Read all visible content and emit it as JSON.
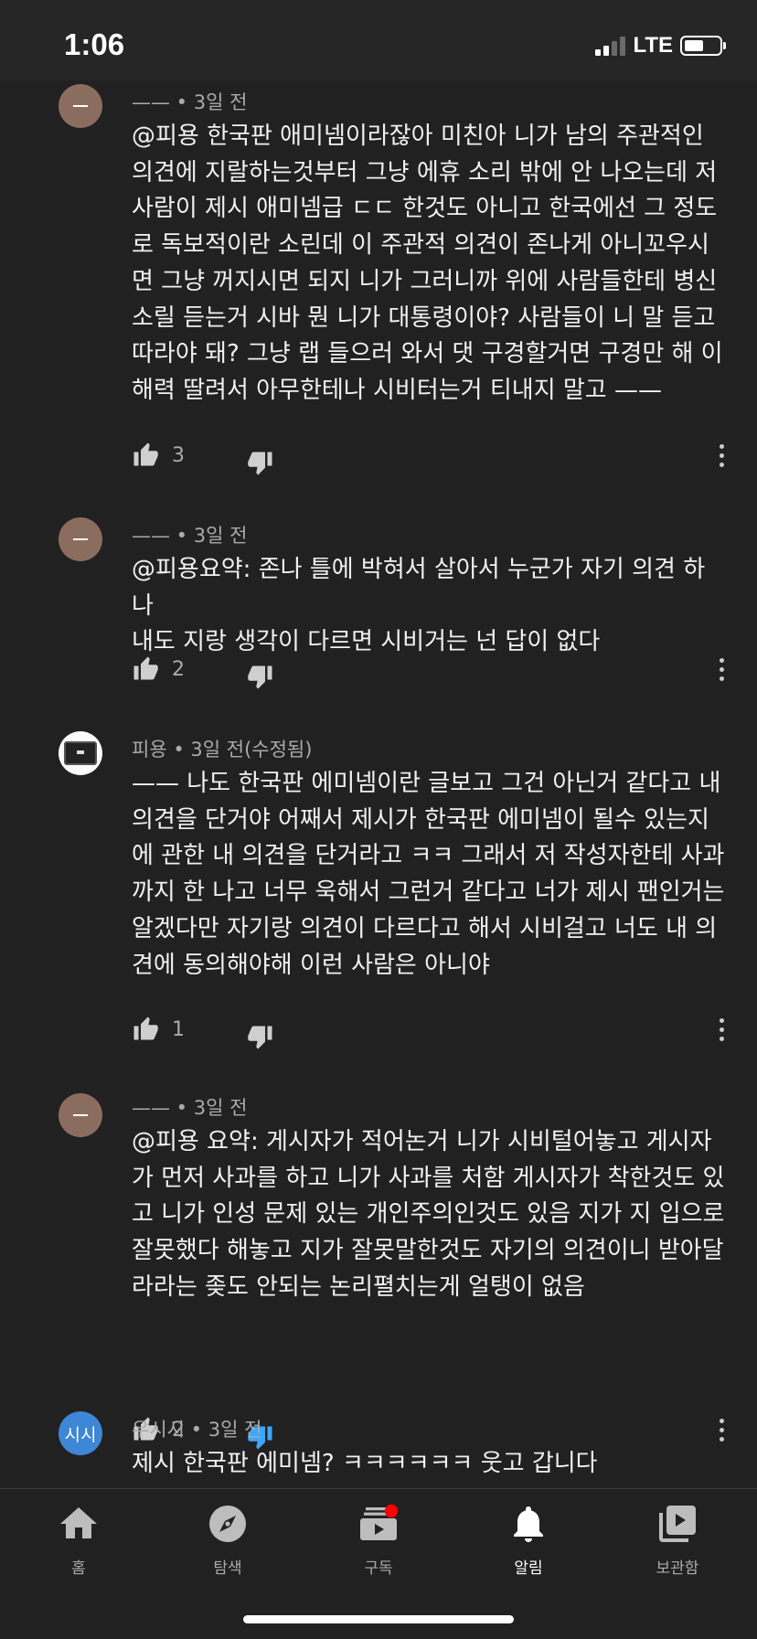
{
  "status": {
    "time": "1:06",
    "network": "LTE"
  },
  "comments": [
    {
      "avatar_initial": "",
      "author": "——",
      "age": "3일 전",
      "text": "@피용 한국판 애미넴이라잖아 미친아 니가 남의 주관적인\n의견에 지랄하는것부터 그냥 에휴 소리 밖에 안 나오는데 저\n사람이 제시 애미넴급 ㄷㄷ 한것도 아니고 한국에선 그 정도\n로 독보적이란 소린데 이 주관적 의견이 존나게 아니꼬우시\n면 그냥 꺼지시면 되지 니가 그러니까 위에 사람들한테 병신\n소릴 듣는거 시바 뭔 니가 대통령이야? 사람들이 니 말 듣고\n따라야 돼? 그냥 랩 들으러 와서 댓 구경할거면 구경만 해 이\n해력 딸려서 아무한테나 시비터는거 티내지 말고 ——",
      "likes": "3",
      "disliked": false
    },
    {
      "avatar_initial": "",
      "author": "——",
      "age": "3일 전",
      "text": "@피용요약:  존나 틀에 박혀서 살아서 누군가 자기 의견 하나\n내도 지랑 생각이 다르면 시비거는 넌 답이 없다",
      "likes": "2",
      "disliked": false
    },
    {
      "avatar_initial": "",
      "author": "피용",
      "age": "3일 전(수정됨)",
      "text": "—— 나도 한국판 에미넴이란 글보고 그건 아닌거 같다고 내\n의견을 단거야 어째서 제시가 한국판 에미넴이 될수 있는지\n에 관한 내 의견을 단거라고 ㅋㅋ 그래서 저 작성자한테 사과\n까지 한 나고 너무 욱해서 그런거 같다고 너가 제시 팬인거는\n알겠다만 자기랑 의견이 다르다고 해서 시비걸고 너도 내 의\n견에 동의해야해 이런 사람은 아니야",
      "likes": "1",
      "disliked": false
    },
    {
      "avatar_initial": "",
      "author": "——",
      "age": "3일 전",
      "text": "@피용 요약: 게시자가 적어논거 니가 시비털어놓고 게시자\n가 먼저 사과를 하고 니가 사과를 처함 게시자가 착한것도 있\n고  니가 인성 문제 있는 개인주의인것도 있음 지가 지 입으로\n잘못했다 해놓고 지가 잘못말한것도 자기의 의견이니 받아달\n라라는 좆도 안되는 논리펼치는게 얼탱이 없음",
      "likes": "2",
      "disliked": true
    },
    {
      "avatar_initial": "시시",
      "author": "우시시",
      "age": "3일 전",
      "text": "제시 한국판 에미넴? ㅋㅋㅋㅋㅋㅋ 웃고 갑니다",
      "likes": "",
      "disliked": false
    }
  ],
  "nav": [
    {
      "label": "홈",
      "icon": "home-icon"
    },
    {
      "label": "탐색",
      "icon": "explore-icon"
    },
    {
      "label": "구독",
      "icon": "subscriptions-icon"
    },
    {
      "label": "알림",
      "icon": "bell-icon"
    },
    {
      "label": "보관함",
      "icon": "library-icon"
    }
  ],
  "colors": {
    "background": "#212121",
    "dislike_active": "#3ea6ff",
    "notification_dot": "#ff0000"
  }
}
